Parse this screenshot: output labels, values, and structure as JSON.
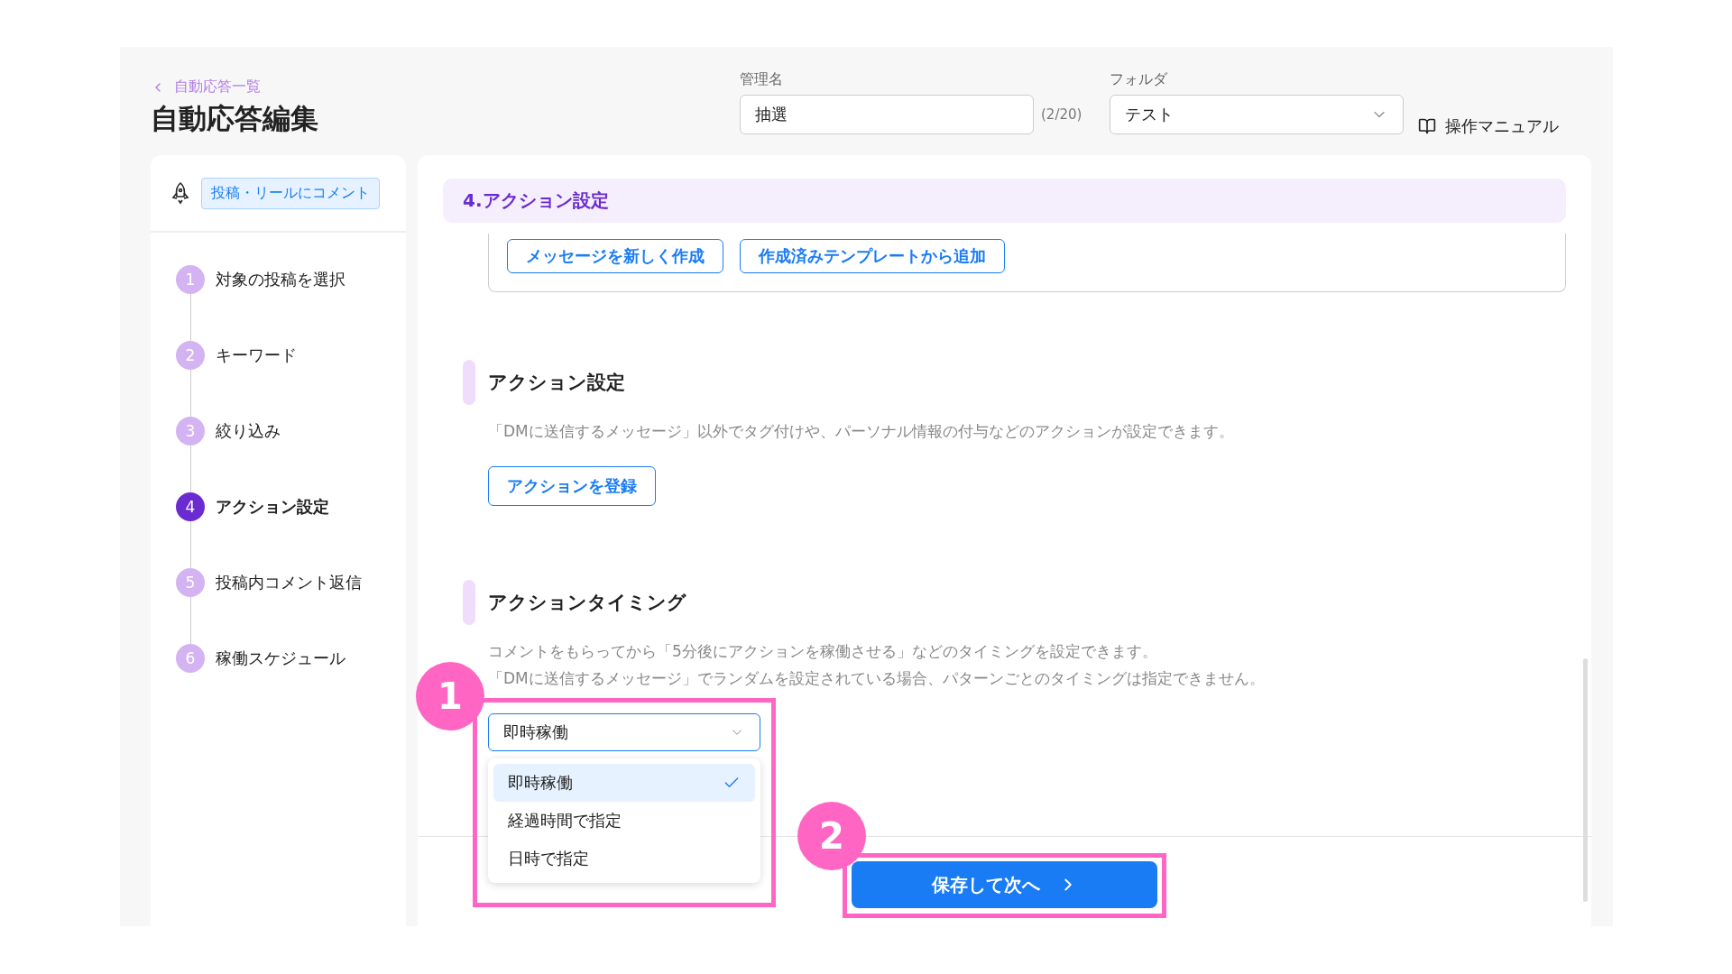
{
  "back_link": "自動応答一覧",
  "title": "自動応答編集",
  "name_field": {
    "label": "管理名",
    "value": "抽選",
    "counter": "(2/20)"
  },
  "folder_field": {
    "label": "フォルダ",
    "value": "テスト"
  },
  "manual_link": "操作マニュアル",
  "sidebar": {
    "trigger_badge": "投稿・リールにコメント",
    "steps": [
      {
        "number": "1",
        "label": "対象の投稿を選択",
        "selected": false
      },
      {
        "number": "2",
        "label": "キーワード",
        "selected": false
      },
      {
        "number": "3",
        "label": "絞り込み",
        "selected": false
      },
      {
        "number": "4",
        "label": "アクション設定",
        "selected": true
      },
      {
        "number": "5",
        "label": "投稿内コメント返信",
        "selected": false
      },
      {
        "number": "6",
        "label": "稼働スケジュール",
        "selected": false
      }
    ]
  },
  "section_header": "4.アクション設定",
  "message_buttons": [
    "メッセージを新しく作成",
    "作成済みテンプレートから追加"
  ],
  "sections": [
    {
      "kind": "button",
      "title": "アクション設定",
      "description_lines": [
        "「DMに送信するメッセージ」以外でタグ付けや、パーソナル情報の付与などのアクションが設定できます。"
      ],
      "button": "アクションを登録"
    },
    {
      "kind": "select",
      "title": "アクションタイミング",
      "description_lines": [
        "コメントをもらってから「5分後にアクションを稼働させる」などのタイミングを設定できます。",
        "「DMに送信するメッセージ」でランダムを設定されている場合、パターンごとのタイミングは指定できません。"
      ],
      "select": {
        "value": "即時稼働",
        "expanded": true,
        "options": [
          {
            "label": "即時稼働",
            "selected": true
          },
          {
            "label": "経過時間で指定",
            "selected": false
          },
          {
            "label": "日時で指定",
            "selected": false
          }
        ]
      }
    }
  ],
  "save_button": "保存して次へ",
  "annotations": [
    {
      "number": "1"
    },
    {
      "number": "2"
    }
  ]
}
